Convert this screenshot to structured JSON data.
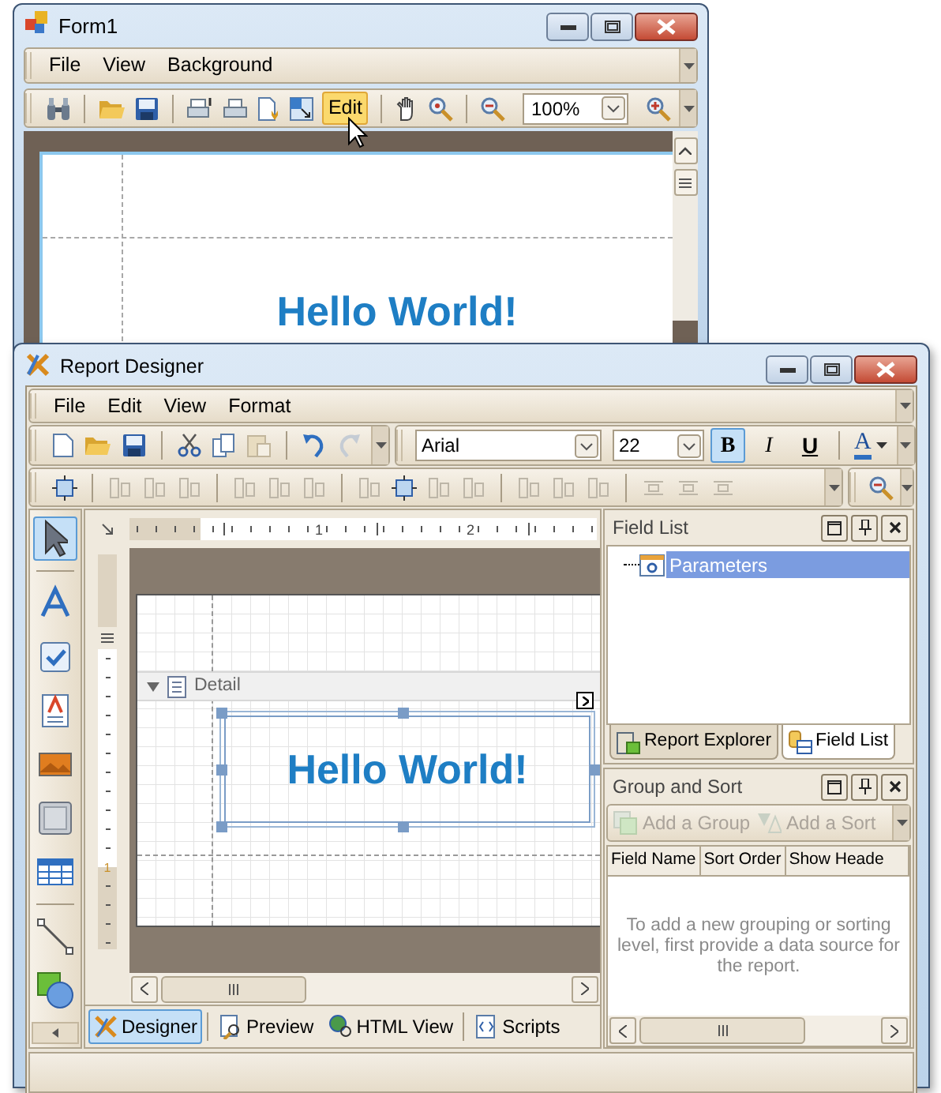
{
  "form1": {
    "title": "Form1",
    "menu": [
      {
        "label": "File"
      },
      {
        "label": "View"
      },
      {
        "label": "Background"
      }
    ],
    "edit_button": {
      "label": "Edit",
      "highlighted": true
    },
    "zoom_field": {
      "value": "100%"
    },
    "page": {
      "text": "Hello World!"
    }
  },
  "report_designer": {
    "title": "Report Designer",
    "menu": [
      {
        "label": "File"
      },
      {
        "label": "Edit"
      },
      {
        "label": "View"
      },
      {
        "label": "Format"
      }
    ],
    "font_field": {
      "value": "Arial"
    },
    "size_field": {
      "value": "22"
    },
    "format_buttons": [
      {
        "label": "B",
        "kind": "bold",
        "selected": true
      },
      {
        "label": "I",
        "kind": "italic",
        "selected": false
      },
      {
        "label": "U",
        "kind": "underline",
        "selected": false
      }
    ],
    "font_color_button": {
      "label": "A"
    },
    "toolbox": [
      {
        "selected": true
      },
      {
        "selected": false
      },
      {
        "selected": false
      },
      {
        "selected": false
      },
      {
        "selected": false
      },
      {
        "selected": false
      },
      {
        "selected": false
      },
      {
        "selected": false
      },
      {
        "selected": false
      }
    ],
    "ruler": {
      "marks": [
        "1",
        "2"
      ]
    },
    "vertical_ruler": {
      "marks": [
        "1"
      ]
    },
    "band": {
      "label": "Detail",
      "expanded": true
    },
    "label_control": {
      "text": "Hello World!",
      "selected": true
    },
    "view_tabs": [
      {
        "label": "Designer",
        "selected": true
      },
      {
        "label": "Preview",
        "selected": false
      },
      {
        "label": "HTML View",
        "selected": false
      },
      {
        "label": "Scripts",
        "selected": false
      }
    ],
    "field_list": {
      "title": "Field List",
      "items": [
        {
          "label": "Parameters",
          "selected": true
        }
      ]
    },
    "dock_tabs": [
      {
        "label": "Report Explorer",
        "selected": false
      },
      {
        "label": "Field List",
        "selected": true
      }
    ],
    "group_sort": {
      "title": "Group and Sort",
      "actions": [
        {
          "label": "Add a Group",
          "disabled": true
        },
        {
          "label": "Add a Sort",
          "disabled": true
        }
      ],
      "columns": [
        "Field Name",
        "Sort Order",
        "Show Heade"
      ],
      "message": "To add a new grouping or sorting level, first provide a data source for the report."
    }
  }
}
